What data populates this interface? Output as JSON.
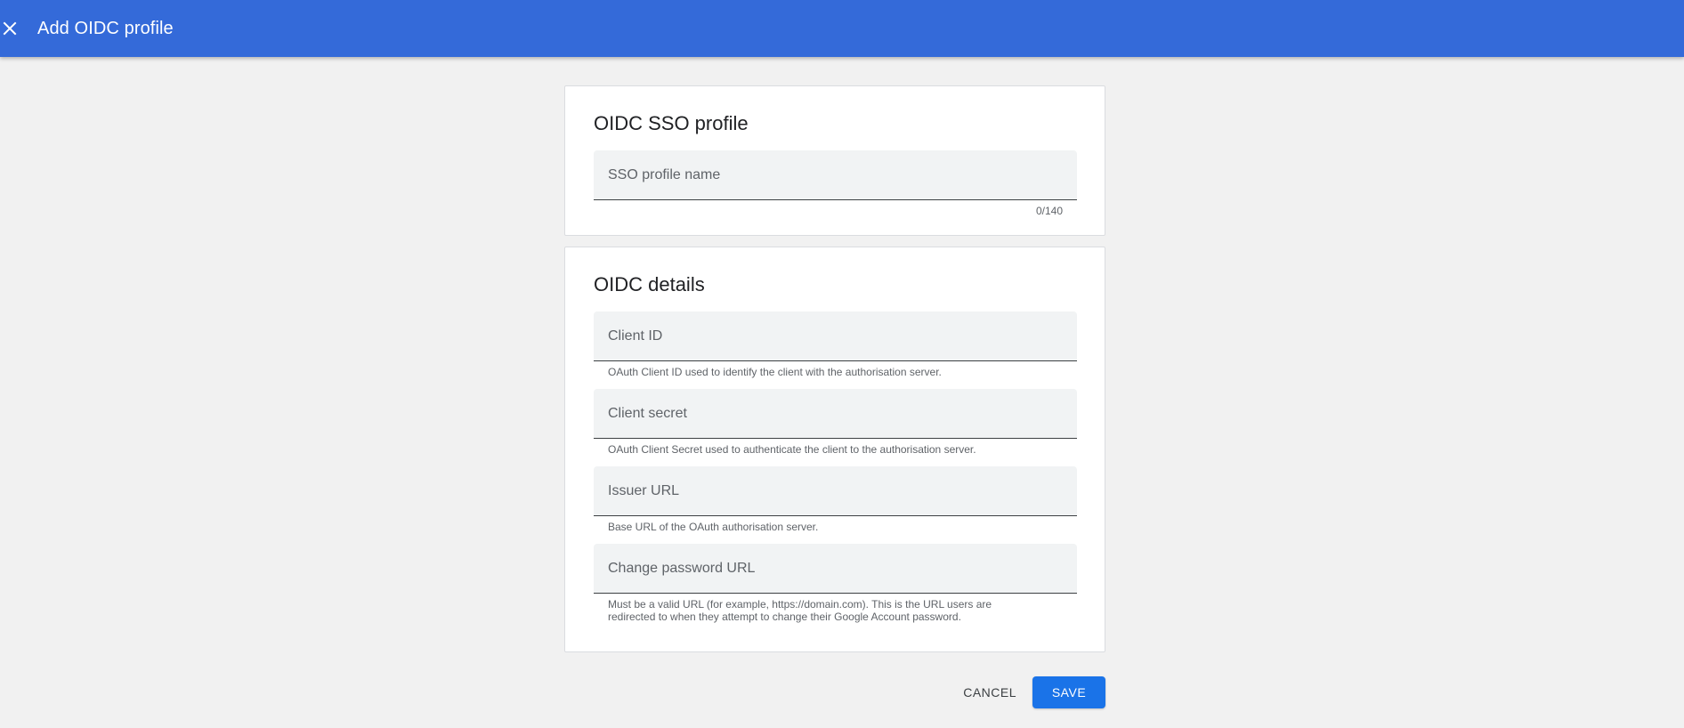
{
  "colors": {
    "header_bg": "#346ad9",
    "primary": "#1a73e8",
    "page_bg": "#f1f1f1"
  },
  "header": {
    "close_icon": "close-icon",
    "title": "Add OIDC profile"
  },
  "sso_profile": {
    "title": "OIDC SSO profile",
    "name_field": {
      "placeholder": "SSO profile name",
      "value": "",
      "counter": "0/140"
    }
  },
  "oidc_details": {
    "title": "OIDC details",
    "client_id": {
      "placeholder": "Client ID",
      "value": "",
      "helper": "OAuth Client ID used to identify the client with the authorisation server."
    },
    "client_secret": {
      "placeholder": "Client secret",
      "value": "",
      "helper": "OAuth Client Secret used to authenticate the client to the authorisation server."
    },
    "issuer_url": {
      "placeholder": "Issuer URL",
      "value": "",
      "helper": "Base URL of the OAuth authorisation server."
    },
    "change_password_url": {
      "placeholder": "Change password URL",
      "value": "",
      "helper": "Must be a valid URL (for example, https://domain.com). This is the URL users are redirected to when they attempt to change their Google Account password."
    }
  },
  "actions": {
    "cancel_label": "CANCEL",
    "save_label": "SAVE"
  }
}
